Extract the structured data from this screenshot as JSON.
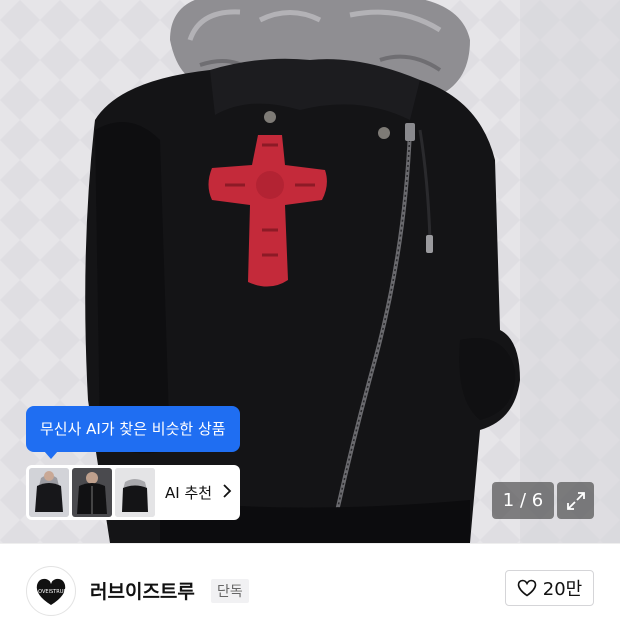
{
  "product_image": {
    "ai_tooltip": "무신사 AI가 찾은 비슷한 상품",
    "ai_card": {
      "label": "AI 추천",
      "chevron_icon": "chevron-right-icon",
      "thumbnails": [
        "thumbnail-1",
        "thumbnail-2",
        "thumbnail-3"
      ]
    },
    "pager": "1 / 6",
    "expand_icon": "expand-icon"
  },
  "brand": {
    "logo_text": "LOVEISTRUE",
    "name": "러브이즈트루",
    "badge": "단독",
    "like_icon": "heart-icon",
    "like_count": "20만"
  },
  "colors": {
    "accent_blue": "#1f6ef2",
    "jacket_black": "#141416",
    "cross_red": "#c42a3a",
    "fur_gray": "#8f8e92"
  }
}
